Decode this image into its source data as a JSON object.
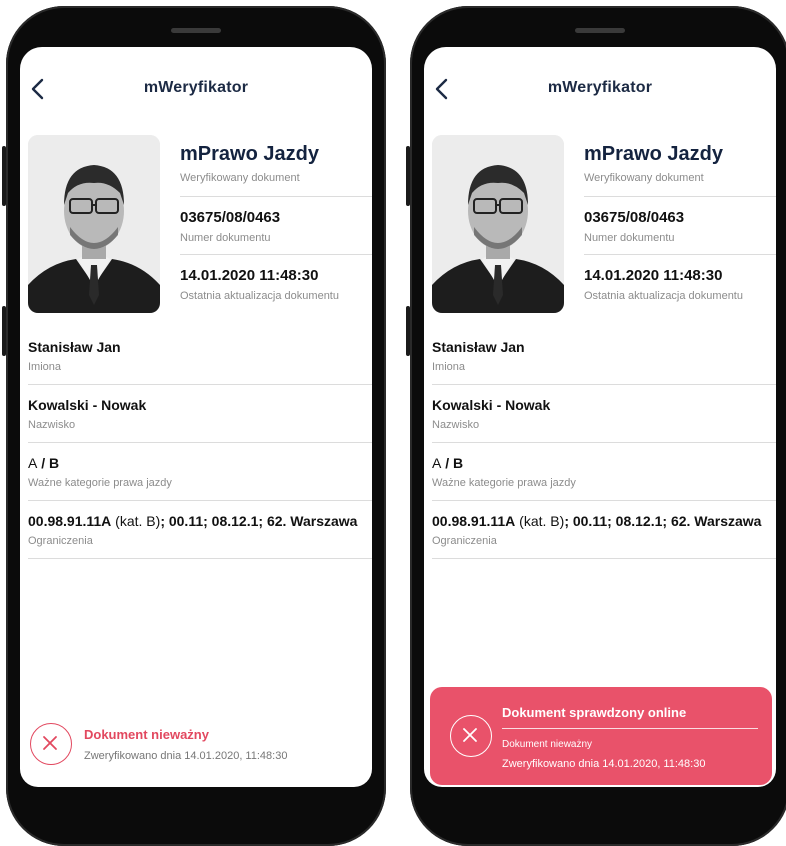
{
  "app": {
    "title": "mWeryfikator"
  },
  "document": {
    "name": "mPrawo Jazdy",
    "name_label": "Weryfikowany dokument",
    "number": "03675/08/0463",
    "number_label": "Numer dokumentu",
    "updated": "14.01.2020 11:48:30",
    "updated_label": "Ostatnia aktualizacja dokumentu"
  },
  "fields": {
    "first_names": {
      "value": "Stanisław Jan",
      "label": "Imiona"
    },
    "surname": {
      "value": "Kowalski - Nowak",
      "label": "Nazwisko"
    },
    "categories": {
      "value_a": "A",
      "separator": " / ",
      "value_b": "B",
      "label": "Ważne kategorie prawa jazdy"
    },
    "restrictions": {
      "code_bold": "00.98.91.11A",
      "code_note": " (kat. B)",
      "rest": "; 00.11; 08.12.1; 62. Warszawa",
      "label": "Ograniczenia"
    }
  },
  "status": {
    "invalid_title": "Dokument nieważny",
    "verified_text": "Zweryfikowano dnia 14.01.2020, 11:48:30",
    "online_title": "Dokument sprawdzony online",
    "online_line1": "Dokument nieważny",
    "online_line2": "Zweryfikowano dnia 14.01.2020, 11:48:30"
  },
  "colors": {
    "accent_red": "#e2485f",
    "card_red": "#e9526a",
    "navy": "#14233f"
  },
  "icons": [
    "chevron-left-icon",
    "close-icon"
  ]
}
